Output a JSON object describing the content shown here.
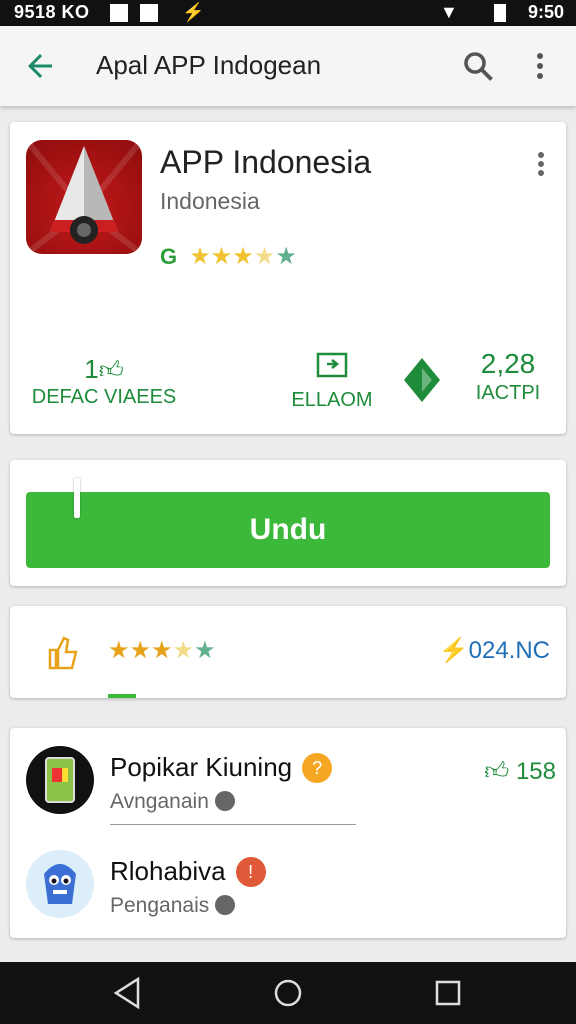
{
  "status_bar": {
    "left": "9518 KO",
    "time": "9:50"
  },
  "app_bar": {
    "title": "Apal APP Indogean"
  },
  "app_card": {
    "name": "APP Indonesia",
    "developer": "Indonesia",
    "rating_letter": "G",
    "stars_filled": 3.5,
    "stats": [
      {
        "value": "1",
        "label": "DEFAC VIAEES"
      },
      {
        "value": "",
        "label": "ELLAOM"
      },
      {
        "value": "2,28",
        "label": "IACTPI"
      }
    ]
  },
  "install": {
    "label": "Undu"
  },
  "rating_row": {
    "stars_filled": 3.5,
    "right_text": "024.NC"
  },
  "related": [
    {
      "name": "Popikar Kiuning",
      "subtitle": "Avnganain",
      "count": "158",
      "badge": "?",
      "badge_color": "#f5a623"
    },
    {
      "name": "Rlohabiva",
      "subtitle": "Penganais",
      "count": "",
      "badge": "!",
      "badge_color": "#e05a3a"
    }
  ],
  "colors": {
    "accent_green": "#3cb83a",
    "stat_green": "#1e8c3a",
    "star_gold": "#f1c232"
  }
}
